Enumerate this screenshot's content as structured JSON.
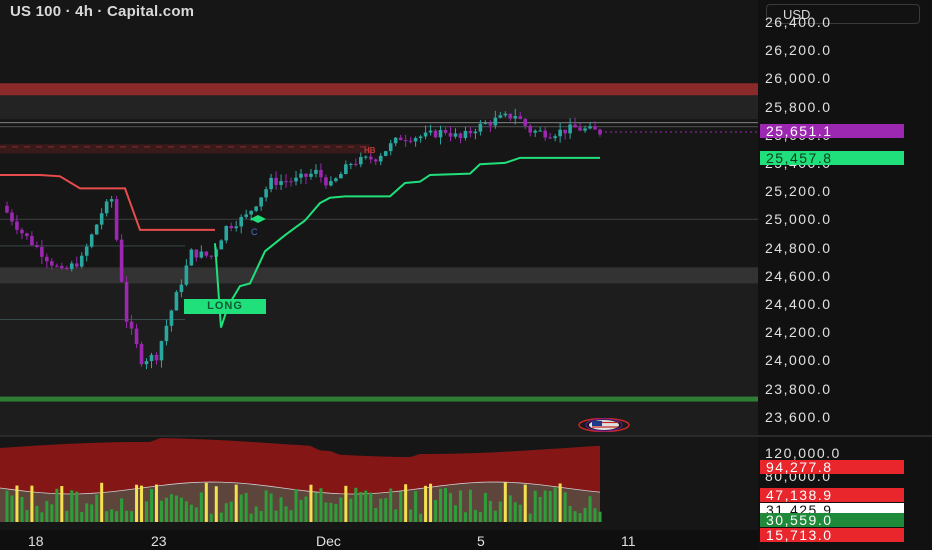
{
  "header": {
    "title": "US 100 · 4h · Capital.com",
    "currency": "USD"
  },
  "price_axis": {
    "labels": [
      "26,400.0",
      "26,200.0",
      "26,000.0",
      "25,800.0",
      "25,600.0",
      "25,400.0",
      "25,200.0",
      "25,000.0",
      "24,800.0",
      "24,600.0",
      "24,400.0",
      "24,200.0",
      "24,000.0",
      "23,800.0",
      "23,600.0"
    ],
    "last_price": "25,651.1",
    "trail_price": "25,457.8"
  },
  "volume_axis": {
    "labels": [
      "120,000.0",
      "80,000.0"
    ],
    "badges": [
      {
        "text": "94,277.8",
        "bg": "#e8262b",
        "fg": "#ffffff"
      },
      {
        "text": "47,138.9",
        "bg": "#e8262b",
        "fg": "#ffffff"
      },
      {
        "text": "31,425.9",
        "bg": "#ffffff",
        "fg": "#111111"
      },
      {
        "text": "30,559.0",
        "bg": "#1f8a3a",
        "fg": "#ffffff"
      },
      {
        "text": "15,713.0",
        "bg": "#e8262b",
        "fg": "#ffffff"
      }
    ]
  },
  "time_axis": {
    "labels": [
      "18",
      "23",
      "Dec",
      "5",
      "11"
    ]
  },
  "chart": {
    "long_label": "LONG",
    "hb_label": "HB",
    "c_label": "C"
  },
  "colors": {
    "background": "#0f0f0f",
    "bull_candle": "#2aa8a0",
    "bear_candle": "#9c27b0",
    "trail_line": "#1fe07a",
    "resistance_band": "#8a2a2a",
    "support_line": "#2e7d32",
    "last_price": "#9c27b0"
  },
  "chart_data": {
    "type": "candlestick",
    "title": "US 100 · 4h · Capital.com",
    "ylim": [
      23500,
      26450
    ],
    "x_ticks": [
      "18",
      "23",
      "Dec",
      "5",
      "11"
    ],
    "last_price": 25651.1,
    "trailing_stop": 25457.8,
    "volume_ticks": [
      120000,
      80000
    ],
    "volume_markers": [
      94277.8,
      47138.9,
      31425.9,
      30559.0,
      15713.0
    ],
    "levels": {
      "resistance_zone": [
        25920,
        26000
      ],
      "lower_zone": [
        24520,
        24640
      ],
      "support_line": 23660
    },
    "anchors": [
      {
        "t": 0,
        "p": 25100
      },
      {
        "t": 4,
        "p": 24900
      },
      {
        "t": 8,
        "p": 24750
      },
      {
        "t": 12,
        "p": 24600
      },
      {
        "t": 16,
        "p": 24700
      },
      {
        "t": 20,
        "p": 25050
      },
      {
        "t": 22,
        "p": 25150
      },
      {
        "t": 25,
        "p": 24250
      },
      {
        "t": 28,
        "p": 23950
      },
      {
        "t": 31,
        "p": 23980
      },
      {
        "t": 34,
        "p": 24320
      },
      {
        "t": 38,
        "p": 24750
      },
      {
        "t": 42,
        "p": 24720
      },
      {
        "t": 45,
        "p": 24940
      },
      {
        "t": 49,
        "p": 25020
      },
      {
        "t": 54,
        "p": 25280
      },
      {
        "t": 59,
        "p": 25290
      },
      {
        "t": 63,
        "p": 25350
      },
      {
        "t": 66,
        "p": 25250
      },
      {
        "t": 70,
        "p": 25420
      },
      {
        "t": 75,
        "p": 25460
      },
      {
        "t": 80,
        "p": 25610
      },
      {
        "t": 85,
        "p": 25620
      },
      {
        "t": 89,
        "p": 25660
      },
      {
        "t": 92,
        "p": 25600
      },
      {
        "t": 95,
        "p": 25680
      },
      {
        "t": 99,
        "p": 25740
      },
      {
        "t": 103,
        "p": 25780
      },
      {
        "t": 106,
        "p": 25660
      },
      {
        "t": 110,
        "p": 25640
      },
      {
        "t": 115,
        "p": 25680
      },
      {
        "t": 120,
        "p": 25651
      }
    ]
  }
}
